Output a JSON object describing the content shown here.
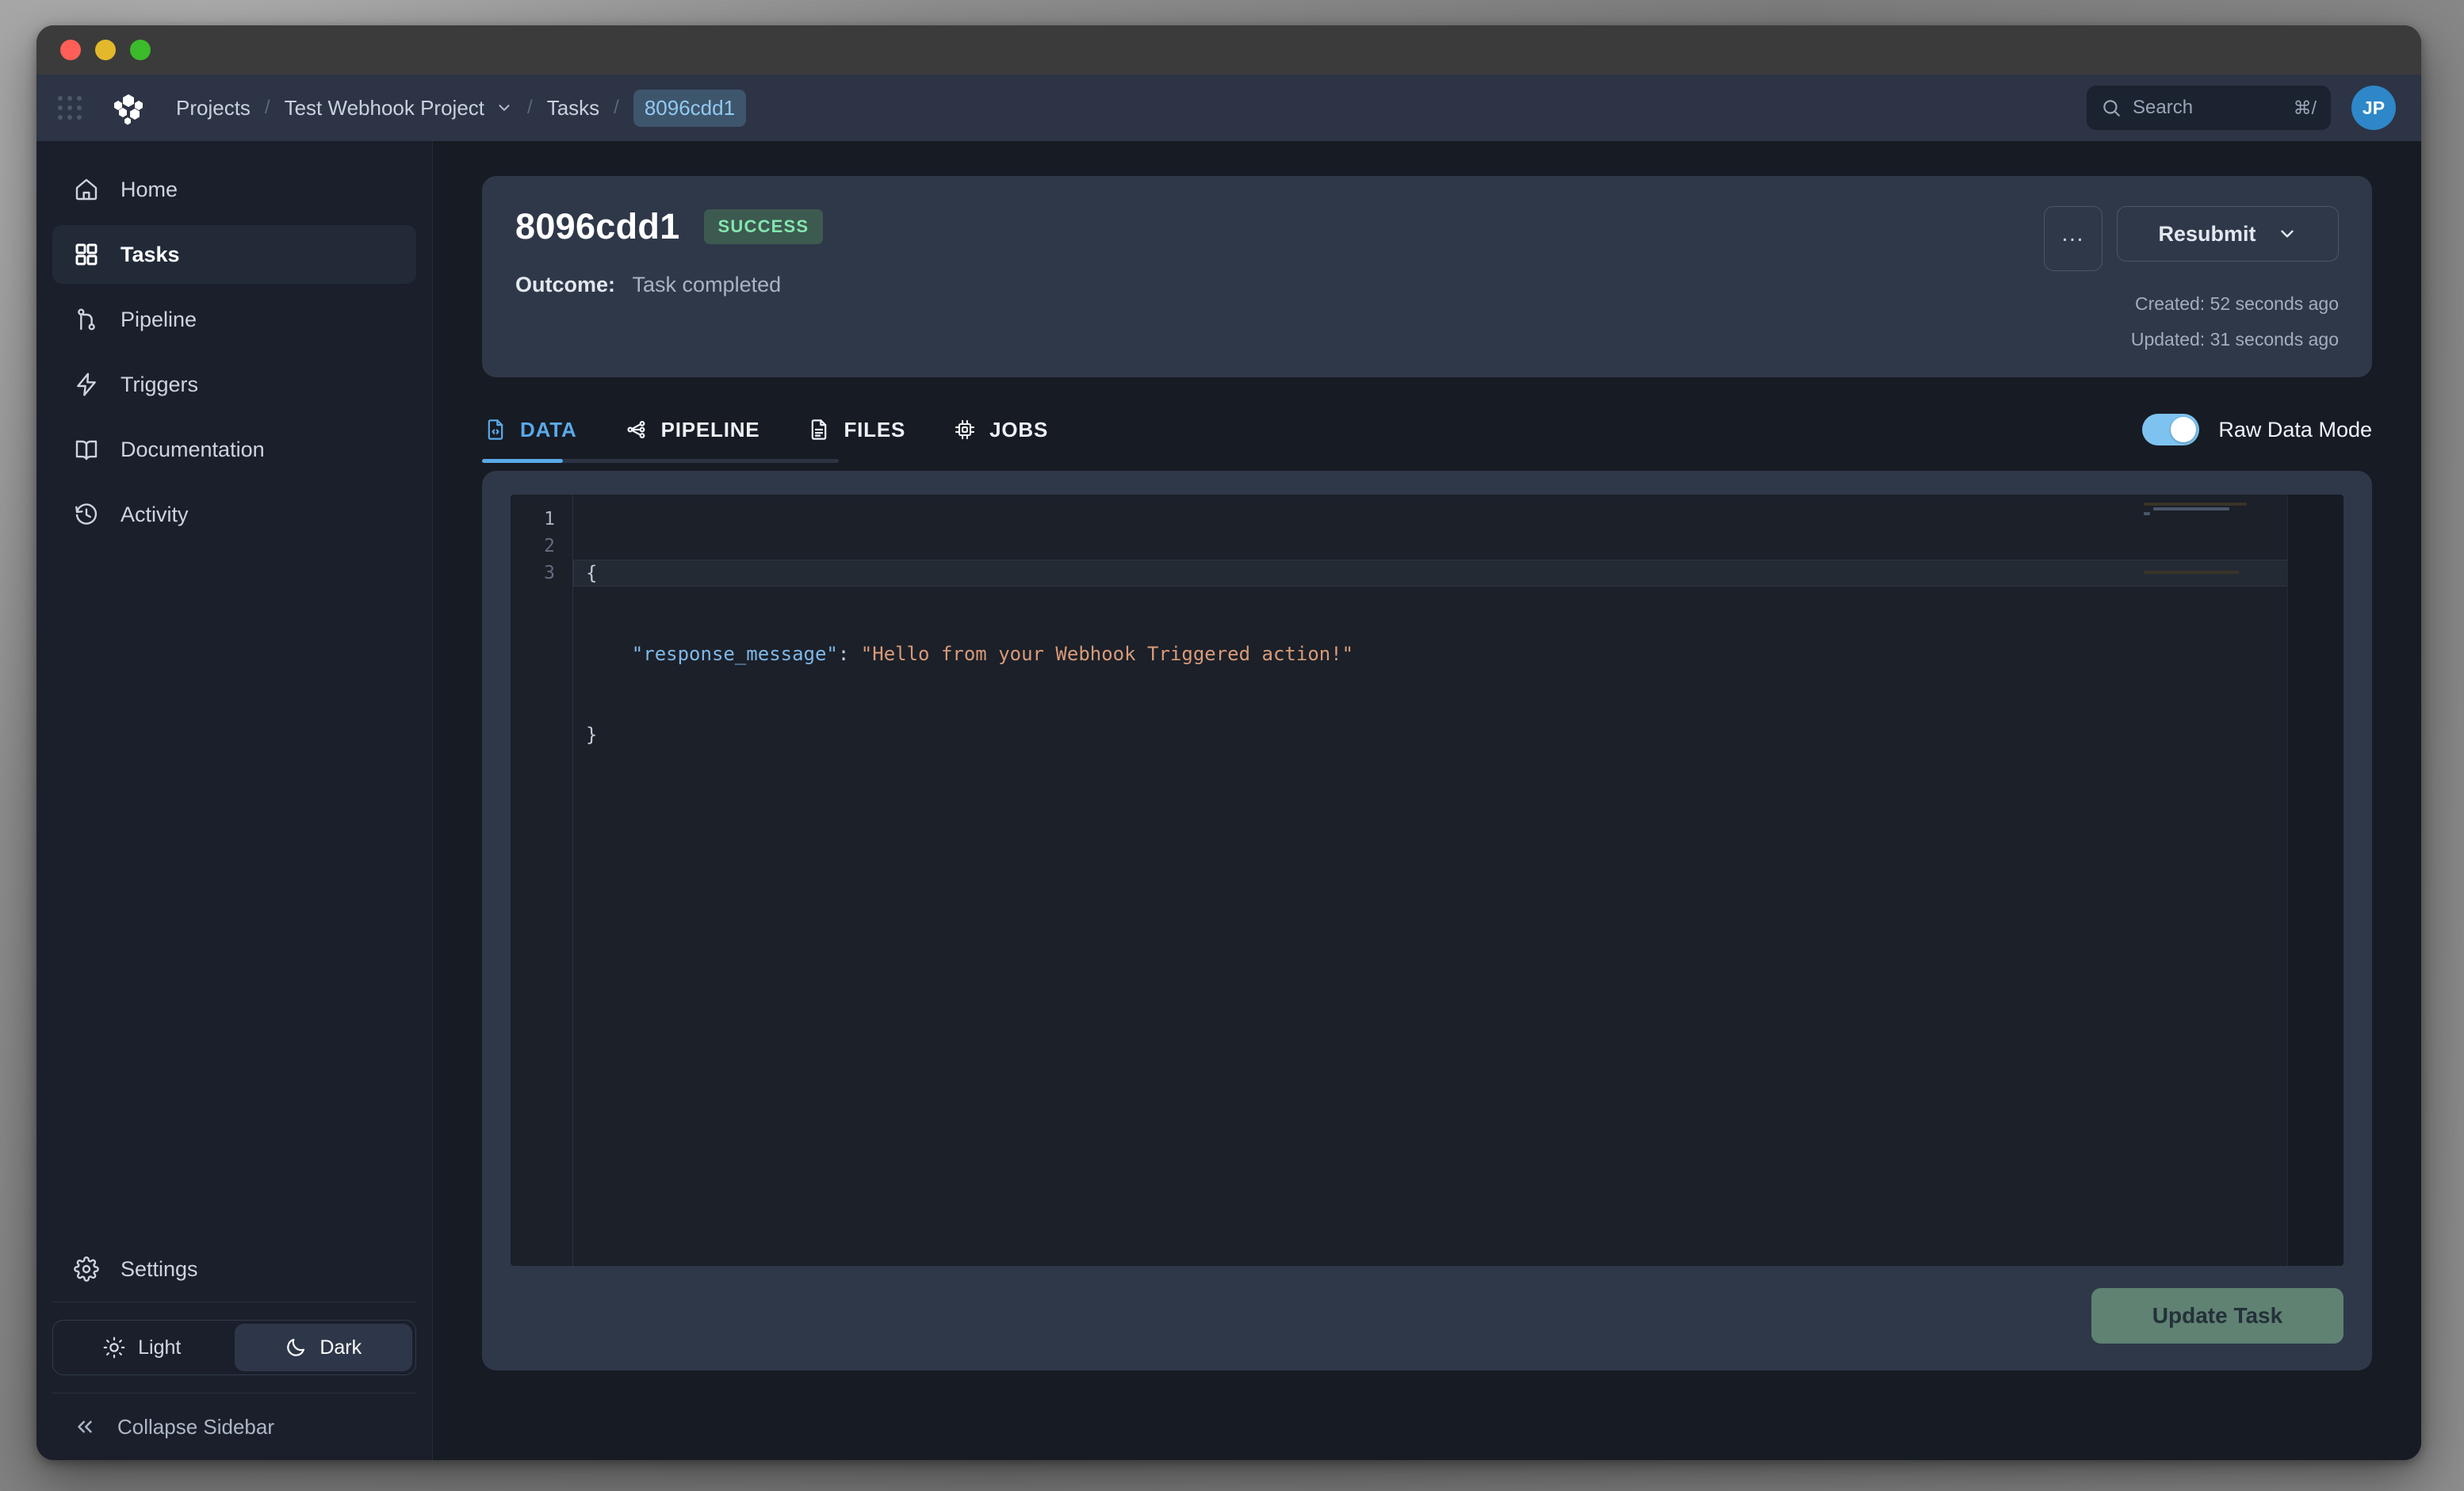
{
  "window": {
    "traffic_lights": [
      "close",
      "minimize",
      "maximize"
    ]
  },
  "topbar": {
    "apps_grid_icon": "apps-grid-icon",
    "logo_icon": "hexagon-cluster-logo",
    "breadcrumb": {
      "items": [
        {
          "label": "Projects",
          "type": "link"
        },
        {
          "label": "Test Webhook Project",
          "type": "link-with-chevron"
        },
        {
          "label": "Tasks",
          "type": "link"
        },
        {
          "label": "8096cdd1",
          "type": "current"
        }
      ],
      "separator": "/"
    },
    "search": {
      "placeholder": "Search",
      "shortcut": "⌘/",
      "icon": "search-icon"
    },
    "avatar": {
      "initials": "JP",
      "color": "#2e87c8"
    }
  },
  "sidebar": {
    "items": [
      {
        "label": "Home",
        "icon": "home-icon",
        "active": false
      },
      {
        "label": "Tasks",
        "icon": "grid-squares-icon",
        "active": true
      },
      {
        "label": "Pipeline",
        "icon": "git-branch-icon",
        "active": false
      },
      {
        "label": "Triggers",
        "icon": "lightning-bolt-icon",
        "active": false
      },
      {
        "label": "Documentation",
        "icon": "book-open-icon",
        "active": false
      },
      {
        "label": "Activity",
        "icon": "clock-history-icon",
        "active": false
      }
    ],
    "settings": {
      "label": "Settings",
      "icon": "gear-icon"
    },
    "theme": {
      "light_label": "Light",
      "dark_label": "Dark",
      "selected": "Dark",
      "light_icon": "sun-icon",
      "dark_icon": "moon-icon"
    },
    "collapse": {
      "label": "Collapse Sidebar",
      "icon": "chevrons-left-icon"
    }
  },
  "task_card": {
    "title": "8096cdd1",
    "status_badge": "SUCCESS",
    "status_color": "#85e6ae",
    "outcome_label": "Outcome:",
    "outcome_value": "Task completed",
    "more_button": "…",
    "resubmit_label": "Resubmit",
    "created": "Created: 52 seconds ago",
    "updated": "Updated: 31 seconds ago"
  },
  "tabs": [
    {
      "label": "DATA",
      "icon": "file-code-icon",
      "active": true
    },
    {
      "label": "PIPELINE",
      "icon": "nodes-graph-icon",
      "active": false
    },
    {
      "label": "FILES",
      "icon": "file-text-icon",
      "active": false
    },
    {
      "label": "JOBS",
      "icon": "cpu-chip-icon",
      "active": false
    }
  ],
  "raw_data_mode": {
    "label": "Raw Data Mode",
    "enabled": true
  },
  "editor": {
    "language": "json",
    "lines": [
      {
        "number": "1",
        "active": true
      },
      {
        "number": "2",
        "active": false
      },
      {
        "number": "3",
        "active": false
      }
    ],
    "line1": "{",
    "line2_key": "\"response_message\"",
    "line2_colon": ": ",
    "line2_value": "\"Hello from your Webhook Triggered action!\"",
    "line3": "}",
    "indent": "    "
  },
  "footer": {
    "update_label": "Update Task"
  }
}
